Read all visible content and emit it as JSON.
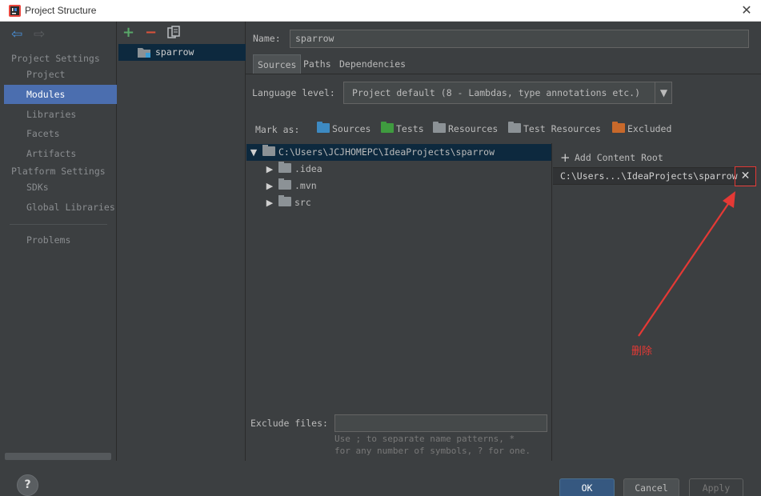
{
  "window": {
    "title": "Project Structure",
    "close_icon": "close-icon"
  },
  "sidebar": {
    "back_icon": "arrow-left-icon",
    "forward_icon": "arrow-right-icon",
    "section_project": "Project Settings",
    "items_project": [
      {
        "label": "Project"
      },
      {
        "label": "Modules"
      },
      {
        "label": "Libraries"
      },
      {
        "label": "Facets"
      },
      {
        "label": "Artifacts"
      }
    ],
    "section_platform": "Platform Settings",
    "items_platform": [
      {
        "label": "SDKs"
      },
      {
        "label": "Global Libraries"
      }
    ],
    "problems": "Problems",
    "selected": "Modules"
  },
  "modules": {
    "add_label": "+",
    "remove_label": "−",
    "copy_icon": "copy-icon",
    "items": [
      {
        "label": "sparrow"
      }
    ]
  },
  "module": {
    "name_label": "Name:",
    "name_value": "sparrow",
    "tabs": [
      {
        "label": "Sources"
      },
      {
        "label": "Paths"
      },
      {
        "label": "Dependencies"
      }
    ],
    "active_tab": "Sources",
    "language_label": "Language level:",
    "language_value": "Project default (8 - Lambdas, type annotations etc.)",
    "mark_as_label": "Mark as:",
    "mark_as": [
      {
        "label": "Sources",
        "color": "#3d8ac2"
      },
      {
        "label": "Tests",
        "color": "#3f9b3f"
      },
      {
        "label": "Resources",
        "color": "#8c9296"
      },
      {
        "label": "Test Resources",
        "color": "#8c9296"
      },
      {
        "label": "Excluded",
        "color": "#c8692b"
      }
    ]
  },
  "tree": {
    "root": "C:\\Users\\JCJHOMEPC\\IdeaProjects\\sparrow",
    "children": [
      {
        "label": ".idea"
      },
      {
        "label": ".mvn"
      },
      {
        "label": "src"
      }
    ]
  },
  "content_roots": {
    "add_label": "Add Content Root",
    "root_path": "C:\\Users...\\IdeaProjects\\sparrow",
    "delete_icon": "close-icon"
  },
  "exclude": {
    "label": "Exclude files:",
    "value": "",
    "hint_line1": "Use ; to separate name patterns, *",
    "hint_line2": "for any number of symbols, ? for one."
  },
  "buttons": {
    "ok": "OK",
    "cancel": "Cancel",
    "apply": "Apply",
    "help": "?"
  },
  "annotation": {
    "text": "删除",
    "color": "#e53935"
  }
}
